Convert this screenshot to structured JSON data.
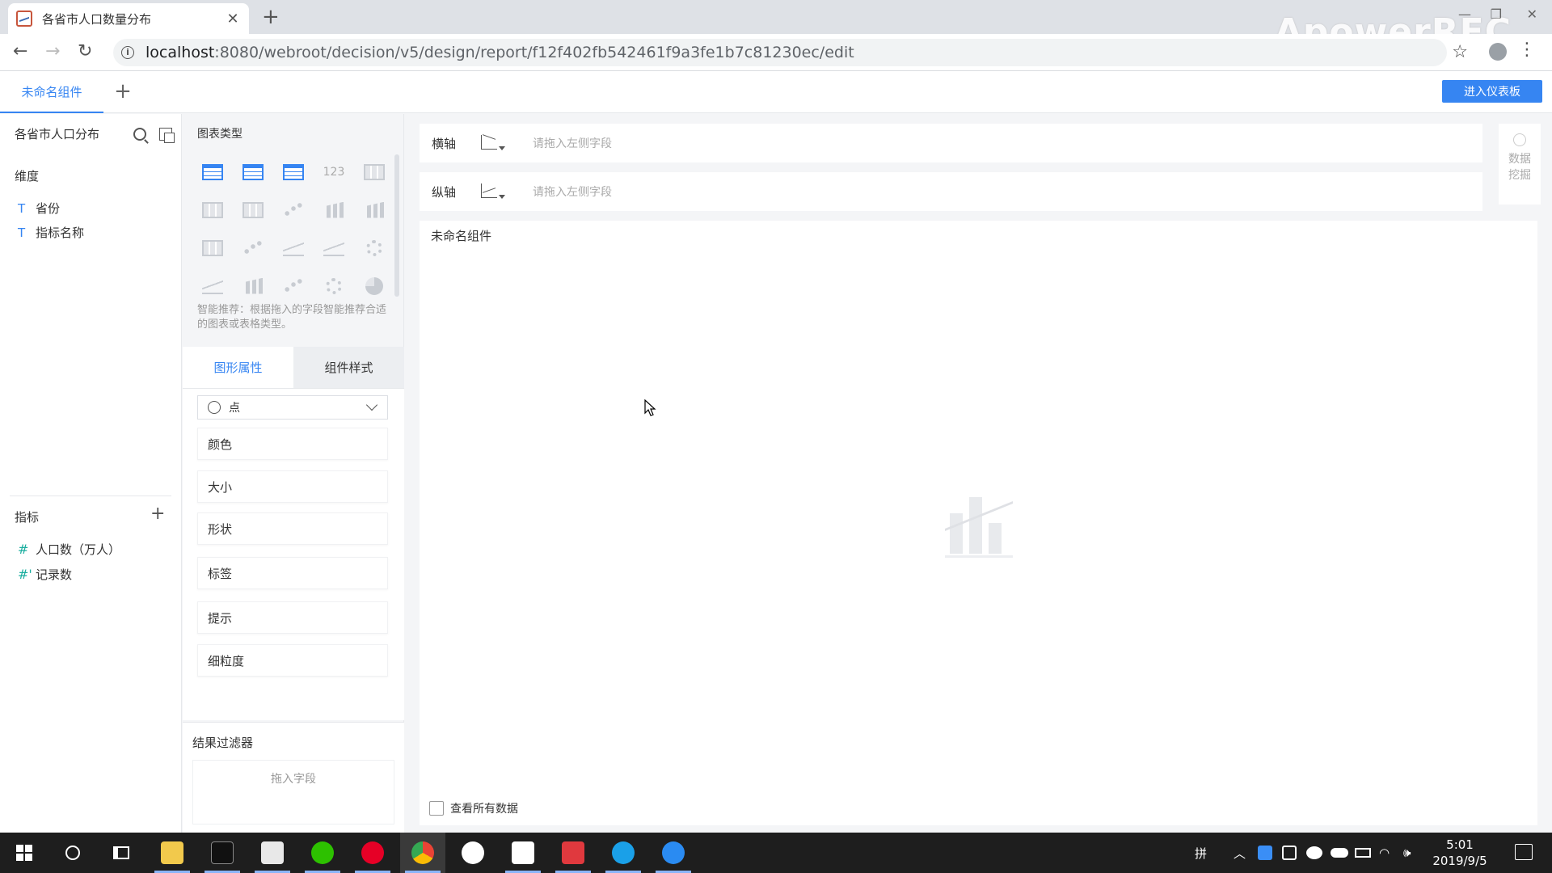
{
  "browser": {
    "tab_title": "各省市人口数量分布",
    "url_host": "localhost",
    "url_path": ":8080/webroot/decision/v5/design/report/f12f402fb542461f9a3fe1b7c81230ec/edit",
    "watermark": "ApowerREC"
  },
  "app": {
    "component_tab": "未命名组件",
    "enter_dashboard_label": "进入仪表板",
    "accent_color": "#3685f2"
  },
  "left_panel": {
    "dataset_name": "各省市人口分布",
    "dimension_label": "维度",
    "dimensions": [
      {
        "type_icon": "T",
        "name": "省份"
      },
      {
        "type_icon": "T",
        "name": "指标名称"
      }
    ],
    "metric_label": "指标",
    "metrics": [
      {
        "type_icon": "#",
        "name": "人口数（万人）"
      },
      {
        "type_icon": "#'",
        "name": "记录数"
      }
    ]
  },
  "mid_panel": {
    "chart_type_label": "图表类型",
    "smart_recommend": "智能推荐：根据拖入的字段智能推荐合适的图表或表格类型。",
    "number_icon_text": "123",
    "tabs": {
      "graphic_props": "图形属性",
      "component_style": "组件样式"
    },
    "mark_type": "点",
    "props": [
      "颜色",
      "大小",
      "形状",
      "标签",
      "提示",
      "细粒度"
    ],
    "filter_label": "结果过滤器",
    "filter_drop": "拖入字段"
  },
  "main": {
    "x_axis_label": "横轴",
    "y_axis_label": "纵轴",
    "axis_placeholder": "请拖入左侧字段",
    "data_mining": "数据挖掘",
    "canvas_title": "未命名组件",
    "view_all": "查看所有数据"
  },
  "taskbar": {
    "ime": "拼",
    "time": "5:01",
    "date": "2019/9/5"
  }
}
